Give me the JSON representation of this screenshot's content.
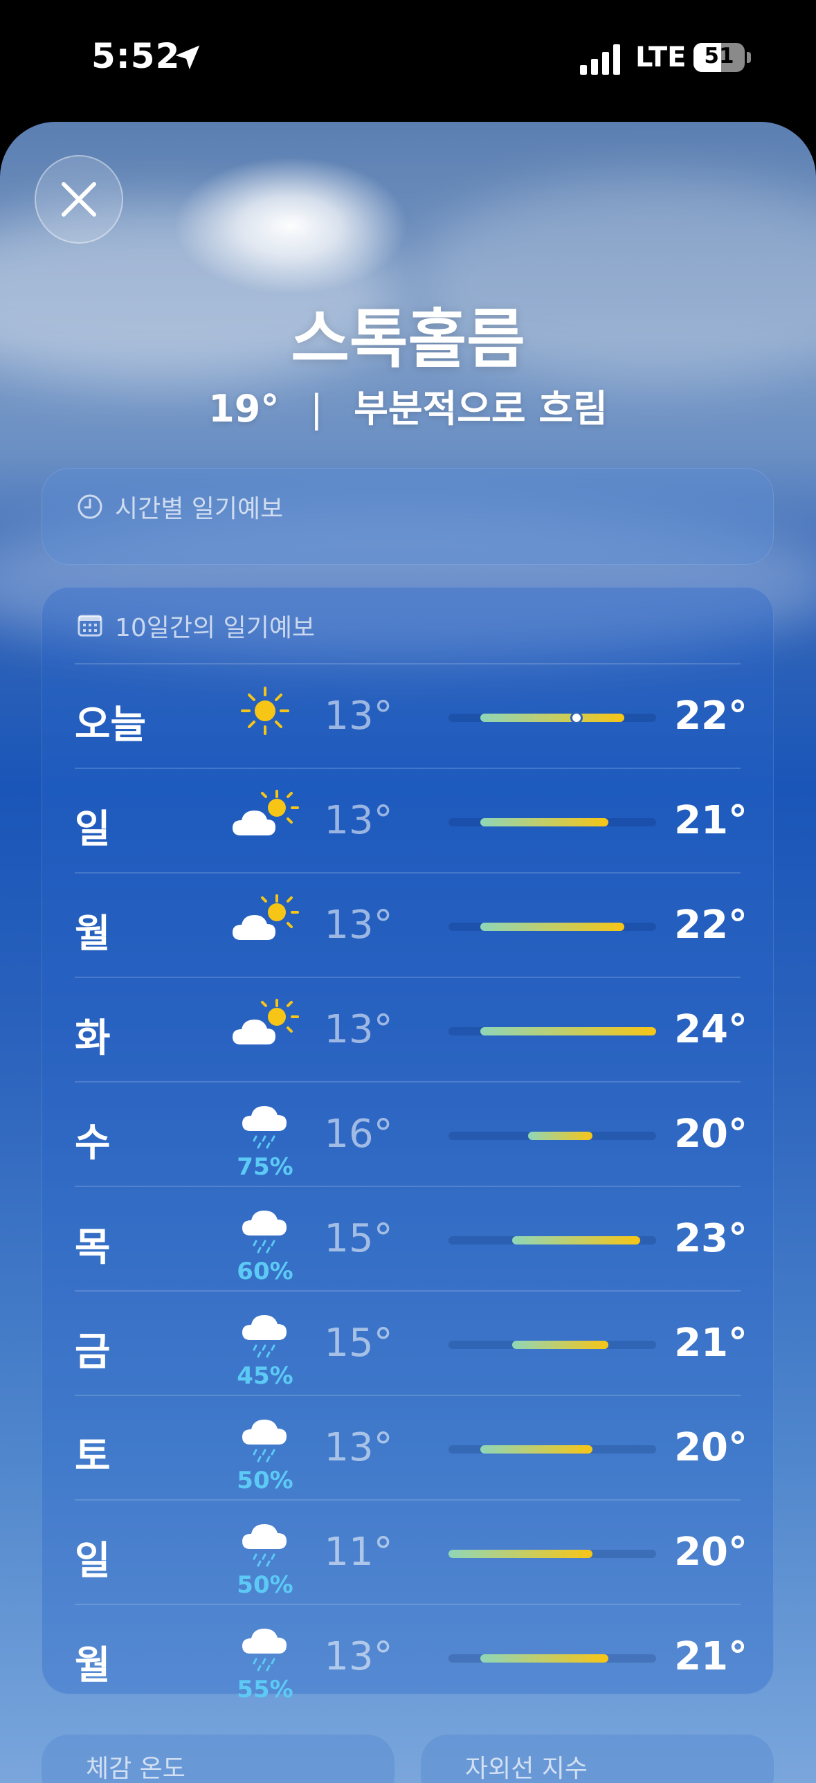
{
  "status_bar": {
    "time": "5:52",
    "network": "LTE",
    "battery": "51"
  },
  "location": {
    "city": "스톡홀름",
    "temperature": "19°",
    "separator": "|",
    "condition": "부분적으로 흐림"
  },
  "hourly_forecast": {
    "title": "시간별 일기예보"
  },
  "daily_forecast": {
    "title": "10일간의 일기예보",
    "range_min": 11,
    "range_max": 24,
    "days": [
      {
        "day": "오늘",
        "icon": "sun-icon",
        "low": "13°",
        "high": "22°",
        "low_val": 13,
        "high_val": 22,
        "current": 19,
        "precip": ""
      },
      {
        "day": "일",
        "icon": "partly-cloudy-icon",
        "low": "13°",
        "high": "21°",
        "low_val": 13,
        "high_val": 21,
        "precip": ""
      },
      {
        "day": "월",
        "icon": "partly-cloudy-icon",
        "low": "13°",
        "high": "22°",
        "low_val": 13,
        "high_val": 22,
        "precip": ""
      },
      {
        "day": "화",
        "icon": "partly-cloudy-icon",
        "low": "13°",
        "high": "24°",
        "low_val": 13,
        "high_val": 24,
        "precip": ""
      },
      {
        "day": "수",
        "icon": "rain-icon",
        "low": "16°",
        "high": "20°",
        "low_val": 16,
        "high_val": 20,
        "precip": "75%"
      },
      {
        "day": "목",
        "icon": "rain-icon",
        "low": "15°",
        "high": "23°",
        "low_val": 15,
        "high_val": 23,
        "precip": "60%"
      },
      {
        "day": "금",
        "icon": "rain-icon",
        "low": "15°",
        "high": "21°",
        "low_val": 15,
        "high_val": 21,
        "precip": "45%"
      },
      {
        "day": "토",
        "icon": "rain-icon",
        "low": "13°",
        "high": "20°",
        "low_val": 13,
        "high_val": 20,
        "precip": "50%"
      },
      {
        "day": "일",
        "icon": "rain-icon",
        "low": "11°",
        "high": "20°",
        "low_val": 11,
        "high_val": 20,
        "precip": "50%"
      },
      {
        "day": "월",
        "icon": "rain-icon",
        "low": "13°",
        "high": "21°",
        "low_val": 13,
        "high_val": 21,
        "precip": "55%"
      }
    ]
  },
  "bottom_cards": [
    {
      "label": "체감 온도"
    },
    {
      "label": "자외선 지수"
    }
  ],
  "colors": {
    "cool": "#8fd6b8",
    "warm": "#f7c516",
    "precip": "#5dcaf5"
  }
}
